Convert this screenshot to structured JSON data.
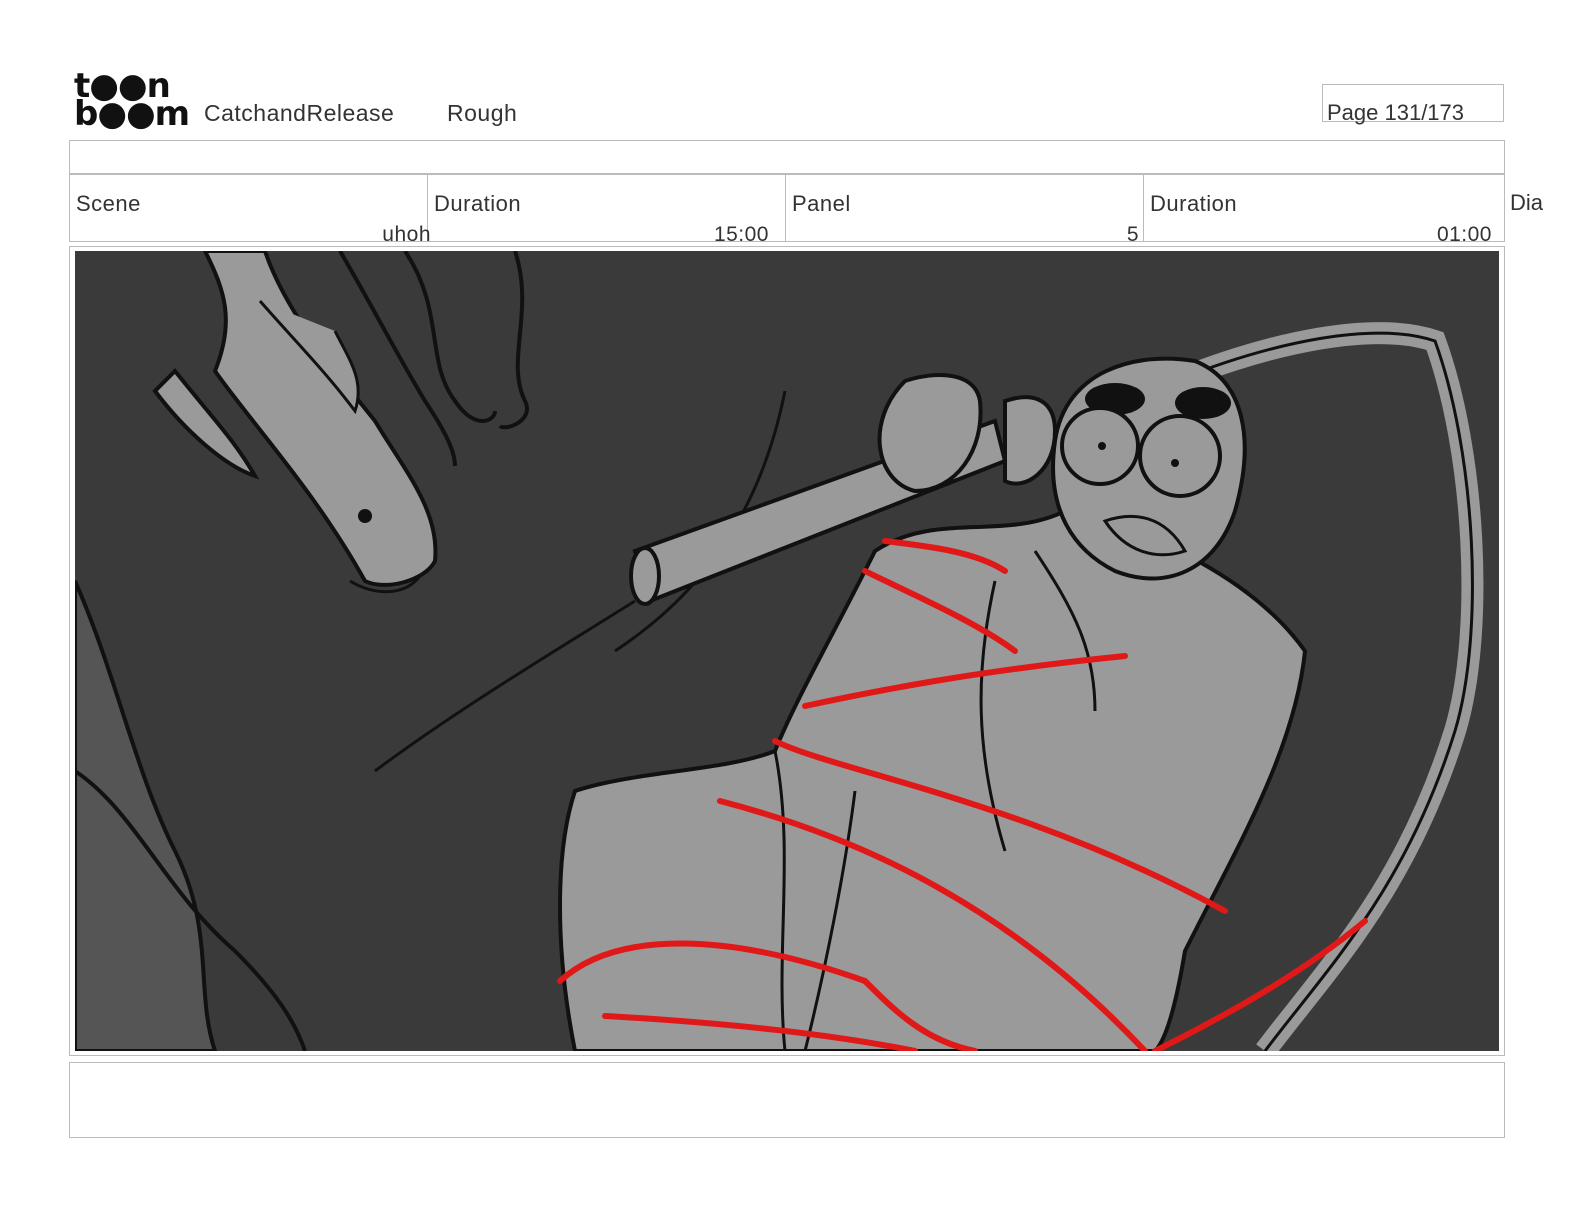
{
  "header": {
    "logo_line1": "t●●n",
    "logo_line2": "b●●m",
    "project": "CatchandRelease",
    "stage": "Rough",
    "page": "Page 131/173"
  },
  "info": {
    "scene_label": "Scene",
    "scene_value": "uhoh",
    "scene_duration_label": "Duration",
    "scene_duration_value": "15:00",
    "panel_label": "Panel",
    "panel_value": "5",
    "panel_duration_label": "Duration",
    "panel_duration_value": "01:00",
    "dialog_label": "Dia"
  },
  "colors": {
    "panel_bg": "#3a3a3a",
    "figure_fill": "#9a9a9a",
    "shadow_fill": "#555555",
    "rope": "#e01818",
    "line": "#111111"
  }
}
